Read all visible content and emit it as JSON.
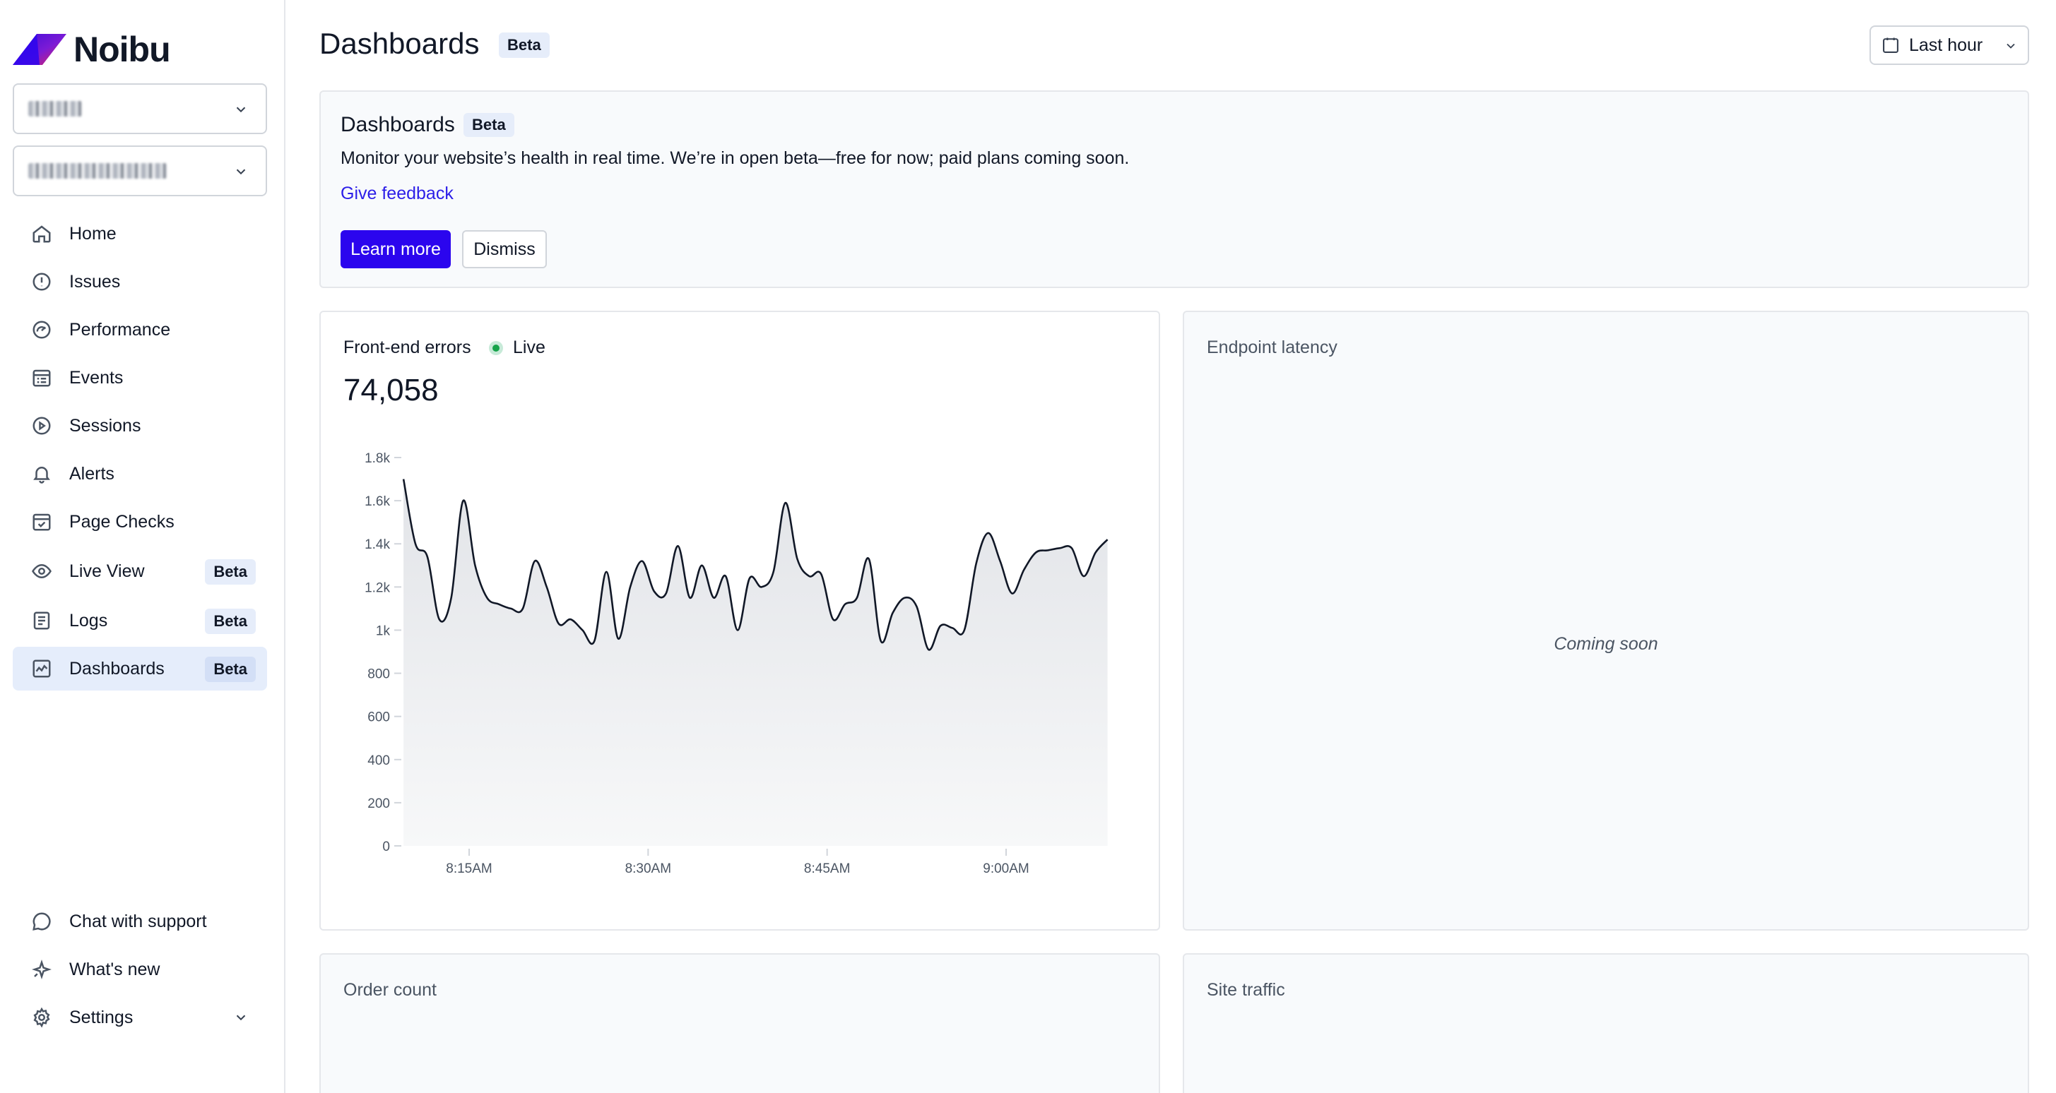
{
  "brand": {
    "name": "Noibu"
  },
  "sidebar": {
    "nav": [
      {
        "label": "Home",
        "icon": "home-icon"
      },
      {
        "label": "Issues",
        "icon": "alert-circle-icon"
      },
      {
        "label": "Performance",
        "icon": "gauge-icon"
      },
      {
        "label": "Events",
        "icon": "events-list-icon"
      },
      {
        "label": "Sessions",
        "icon": "play-circle-icon"
      },
      {
        "label": "Alerts",
        "icon": "bell-icon"
      },
      {
        "label": "Page Checks",
        "icon": "calendar-check-icon"
      },
      {
        "label": "Live View",
        "icon": "eye-icon",
        "badge": "Beta"
      },
      {
        "label": "Logs",
        "icon": "logs-icon",
        "badge": "Beta"
      },
      {
        "label": "Dashboards",
        "icon": "dashboard-icon",
        "badge": "Beta",
        "active": true
      }
    ],
    "footer": [
      {
        "label": "Chat with support",
        "icon": "chat-bubble-icon"
      },
      {
        "label": "What's new",
        "icon": "sparkle-icon"
      },
      {
        "label": "Settings",
        "icon": "gear-icon"
      }
    ]
  },
  "header": {
    "title": "Dashboards",
    "badge": "Beta",
    "time_range": "Last hour"
  },
  "banner": {
    "title": "Dashboards",
    "badge": "Beta",
    "description": "Monitor your website’s health in real time. We’re in open beta—free for now; paid plans coming soon.",
    "link": "Give feedback",
    "primary_button": "Learn more",
    "secondary_button": "Dismiss"
  },
  "cards": {
    "errors": {
      "title": "Front-end errors",
      "live_label": "Live",
      "value": "74,058"
    },
    "latency": {
      "title": "Endpoint latency",
      "status": "Coming soon"
    },
    "orders": {
      "title": "Order count"
    },
    "traffic": {
      "title": "Site traffic"
    }
  },
  "colors": {
    "accent": "#2b05ee",
    "link": "#2c1ee8",
    "live": "#16a34a",
    "badge_bg": "#e6edfa",
    "active_bg": "#e5edfb"
  },
  "chart_data": {
    "type": "area",
    "title": "Front-end errors",
    "xlabel": "",
    "ylabel": "",
    "ylim": [
      0,
      1800
    ],
    "yticks": [
      "0",
      "200",
      "400",
      "600",
      "800",
      "1k",
      "1.2k",
      "1.4k",
      "1.6k",
      "1.8k"
    ],
    "xticks": [
      {
        "label": "8:15AM",
        "minute": 15
      },
      {
        "label": "8:30AM",
        "minute": 30
      },
      {
        "label": "8:45AM",
        "minute": 45
      },
      {
        "label": "9:00AM",
        "minute": 60
      }
    ],
    "grid": false,
    "series": [
      {
        "values": [
          [
            9.5,
            1700
          ],
          [
            10.5,
            1400
          ],
          [
            11.5,
            1340
          ],
          [
            12.5,
            1050
          ],
          [
            13.5,
            1150
          ],
          [
            14.5,
            1600
          ],
          [
            15.5,
            1300
          ],
          [
            16.5,
            1150
          ],
          [
            17.5,
            1120
          ],
          [
            18.5,
            1100
          ],
          [
            19.5,
            1100
          ],
          [
            20.5,
            1320
          ],
          [
            21.5,
            1200
          ],
          [
            22.5,
            1030
          ],
          [
            23.5,
            1050
          ],
          [
            24.5,
            1000
          ],
          [
            25.5,
            950
          ],
          [
            26.5,
            1270
          ],
          [
            27.5,
            960
          ],
          [
            28.5,
            1200
          ],
          [
            29.5,
            1320
          ],
          [
            30.5,
            1180
          ],
          [
            31.5,
            1170
          ],
          [
            32.5,
            1390
          ],
          [
            33.5,
            1150
          ],
          [
            34.5,
            1300
          ],
          [
            35.5,
            1150
          ],
          [
            36.5,
            1250
          ],
          [
            37.5,
            1000
          ],
          [
            38.5,
            1240
          ],
          [
            39.5,
            1200
          ],
          [
            40.5,
            1270
          ],
          [
            41.5,
            1590
          ],
          [
            42.5,
            1330
          ],
          [
            43.5,
            1250
          ],
          [
            44.5,
            1260
          ],
          [
            45.5,
            1050
          ],
          [
            46.5,
            1120
          ],
          [
            47.5,
            1150
          ],
          [
            48.5,
            1330
          ],
          [
            49.5,
            950
          ],
          [
            50.5,
            1080
          ],
          [
            51.5,
            1150
          ],
          [
            52.5,
            1110
          ],
          [
            53.5,
            910
          ],
          [
            54.5,
            1020
          ],
          [
            55.5,
            1010
          ],
          [
            56.5,
            1000
          ],
          [
            57.5,
            1310
          ],
          [
            58.5,
            1450
          ],
          [
            59.5,
            1320
          ],
          [
            60.5,
            1170
          ],
          [
            61.5,
            1280
          ],
          [
            62.5,
            1360
          ],
          [
            63.5,
            1370
          ],
          [
            64.5,
            1380
          ],
          [
            65.5,
            1380
          ],
          [
            66.5,
            1250
          ],
          [
            67.5,
            1360
          ],
          [
            68.5,
            1420
          ]
        ]
      }
    ]
  }
}
